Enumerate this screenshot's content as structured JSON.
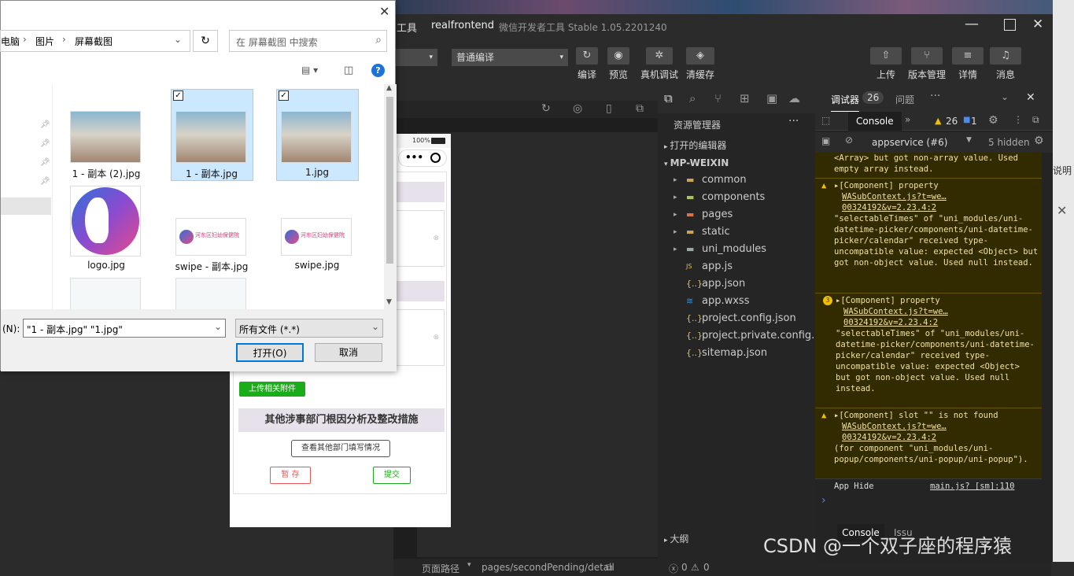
{
  "ide": {
    "title_app": "realfrontend",
    "title_sub": "微信开发者工具 Stable 1.05.2201240",
    "title_prefix": "工具",
    "mode_select": "",
    "compile_select": "普通编译",
    "buttons": {
      "compile": "编译",
      "preview": "预览",
      "realdebug": "真机调试",
      "clearcache": "清缓存",
      "upload": "上传",
      "version": "版本管理",
      "details": "详情",
      "messages": "消息"
    },
    "statusbar": {
      "path_label": "页面路径",
      "path": "pages/secondPending/detail",
      "errors": "0",
      "warnings": "0"
    }
  },
  "explorer": {
    "title": "资源管理器",
    "open_editors": "打开的编辑器",
    "project": "MP-WEIXIN",
    "items": [
      {
        "name": "common",
        "type": "folder"
      },
      {
        "name": "components",
        "type": "folder"
      },
      {
        "name": "pages",
        "type": "folder"
      },
      {
        "name": "static",
        "type": "folder"
      },
      {
        "name": "uni_modules",
        "type": "folder"
      },
      {
        "name": "app.js",
        "type": "js"
      },
      {
        "name": "app.json",
        "type": "json"
      },
      {
        "name": "app.wxss",
        "type": "css"
      },
      {
        "name": "project.config.json",
        "type": "json"
      },
      {
        "name": "project.private.config.js...",
        "type": "json"
      },
      {
        "name": "sitemap.json",
        "type": "json"
      }
    ],
    "outline": "大纲"
  },
  "console": {
    "tab_debugger": "调试器",
    "debugger_count": "26",
    "tab_issues": "问题",
    "tab_console": "Console",
    "warn_count": "26",
    "info_count": "1",
    "context": "appservice (#6)",
    "hidden": "5 hidden",
    "messages": [
      {
        "head": "",
        "link": "",
        "body": "<Array> but got non-array value. Used empty array instead."
      },
      {
        "head": "▸[Component] property",
        "link": "WASubContext.js?t=we…00324192&v=2.23.4:2",
        "body": "\"selectableTimes\" of \"uni_modules/uni-datetime-picker/components/uni-datetime-picker/calendar\" received type-uncompatible value: expected <Object> but got non-object value. Used null instead."
      },
      {
        "head": "▸[Component] property",
        "link": "WASubContext.js?t=we…00324192&v=2.23.4:2",
        "body": "\"selectableTimes\" of \"uni_modules/uni-datetime-picker/components/uni-datetime-picker/calendar\" received type-uncompatible value: expected <Object> but got non-object value. Used null instead.",
        "badge": "3"
      },
      {
        "head": "▸[Component] slot \"\" is not found",
        "link": "WASubContext.js?t=we…00324192&v=2.23.4:2",
        "body": "(for component \"uni_modules/uni-popup/components/uni-popup/uni-popup\")."
      }
    ],
    "app_hide": "App Hide",
    "app_hide_link": "main.js? [sm]:110",
    "prompt": "›",
    "bottom_tab": "Console",
    "bottom_tab2": "Issu"
  },
  "phone": {
    "battery": "100%",
    "upload_btn": "上传相关附件",
    "section_title": "其他涉事部门根因分析及整改措施",
    "view_btn": "查看其他部门填写情况",
    "save_btn": "暂 存",
    "submit_btn": "提交"
  },
  "dialog": {
    "breadcrumb": [
      "电脑",
      "图片",
      "屏幕截图"
    ],
    "search_placeholder": "在 屏幕截图 中搜索",
    "files": [
      {
        "name": "1 - 副本 (2).jpg",
        "selected": false
      },
      {
        "name": "1 - 副本.jpg",
        "selected": true
      },
      {
        "name": "1.jpg",
        "selected": true
      },
      {
        "name": "logo.jpg",
        "selected": false
      },
      {
        "name": "swipe - 副本.jpg",
        "selected": false
      },
      {
        "name": "swipe.jpg",
        "selected": false
      }
    ],
    "filename_label": "(N):",
    "filename_value": "\"1 - 副本.jpg\" \"1.jpg\"",
    "filetype": "所有文件 (*.*)",
    "open_btn": "打开(O)",
    "cancel_btn": "取消",
    "swipe_caption": "河东区妇幼保健院"
  },
  "watermark": "CSDN @一个双子座的程序猿",
  "right_edge": "说明"
}
